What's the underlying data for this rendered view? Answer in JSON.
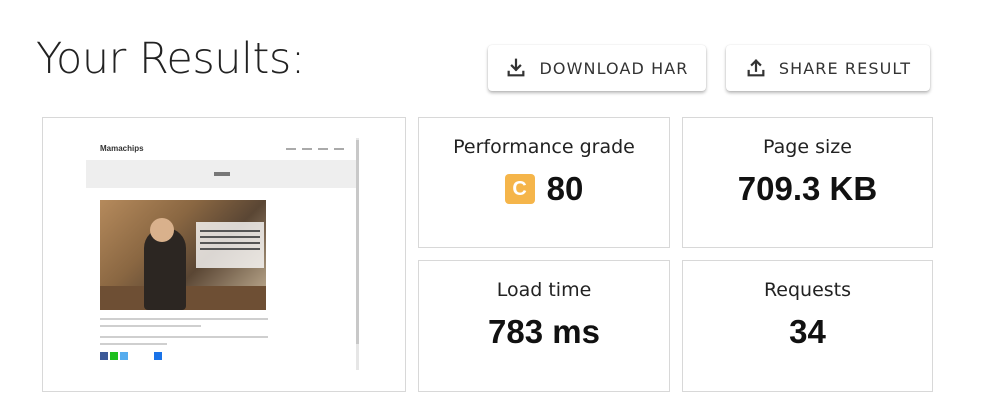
{
  "title": "Your Results:",
  "actions": {
    "download_label": "DOWNLOAD HAR",
    "share_label": "SHARE RESULT"
  },
  "preview": {
    "site_name": "Mamachips"
  },
  "stats": {
    "performance": {
      "label": "Performance grade",
      "grade": "C",
      "value": "80",
      "grade_color": "#f5b54a"
    },
    "page_size": {
      "label": "Page size",
      "value": "709.3 KB"
    },
    "load_time": {
      "label": "Load time",
      "value": "783 ms"
    },
    "requests": {
      "label": "Requests",
      "value": "34"
    }
  },
  "icons": {
    "download": "download-icon",
    "share": "share-icon"
  }
}
